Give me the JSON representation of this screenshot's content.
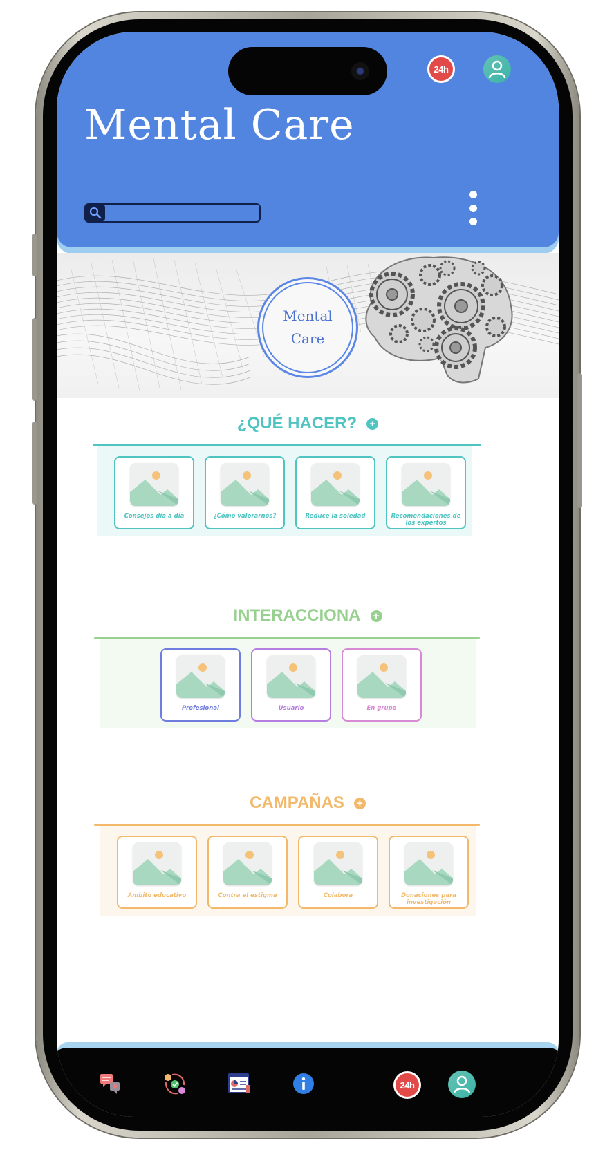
{
  "header": {
    "title": "Mental Care",
    "badge_24h": "24h",
    "search_placeholder": ""
  },
  "hero": {
    "badge_line1": "Mental",
    "badge_line2": "Care"
  },
  "sections": {
    "que_hacer": {
      "title": "¿QUÉ HACER?",
      "color": "#4fc4c0",
      "cards": [
        "Consejos día a día",
        "¿Cómo valorarnos?",
        "Reduce la soledad",
        "Recomendaciones de los expertos"
      ]
    },
    "interacciona": {
      "title": "INTERACCIONA",
      "color": "#97d08f",
      "cards": [
        "Profesional",
        "Usuario",
        "En grupo"
      ],
      "card_colors": [
        "#6f7de0",
        "#b67ee0",
        "#d88ad4"
      ]
    },
    "campanas": {
      "title": "CAMPAÑAS",
      "color": "#f2b96b",
      "cards": [
        "Ámbito educativo",
        "Contra el estigma",
        "Colabora",
        "Donaciones para investigación"
      ]
    }
  },
  "bottom_nav": {
    "badge_24h": "24h",
    "icons": [
      "chat-icon",
      "exchange-icon",
      "report-icon",
      "info-icon",
      "emergency-24h-icon",
      "profile-icon"
    ]
  },
  "colors": {
    "header_blue": "#5285e0",
    "accent_light_blue": "#9fcdf0"
  }
}
